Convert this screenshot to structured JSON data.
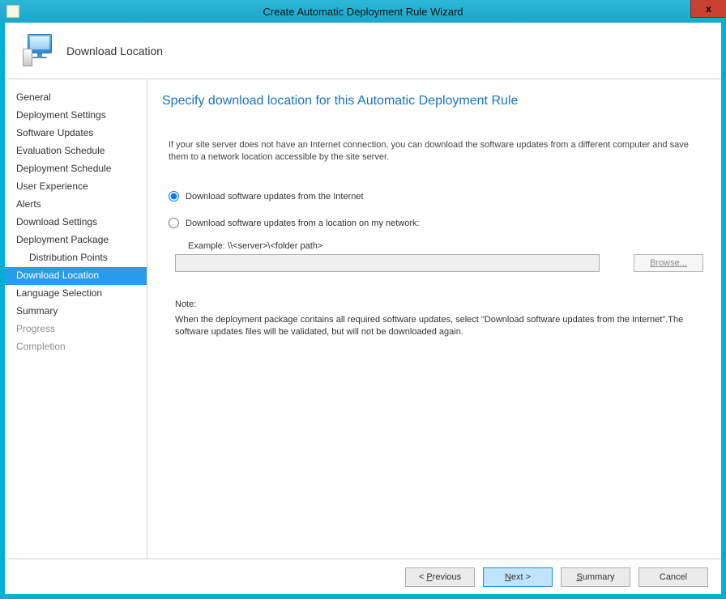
{
  "window": {
    "title": "Create Automatic Deployment Rule Wizard",
    "close": "x"
  },
  "header": {
    "page_title": "Download Location"
  },
  "sidebar": {
    "items": [
      {
        "label": "General",
        "child": false,
        "disabled": false
      },
      {
        "label": "Deployment Settings",
        "child": false,
        "disabled": false
      },
      {
        "label": "Software Updates",
        "child": false,
        "disabled": false
      },
      {
        "label": "Evaluation Schedule",
        "child": false,
        "disabled": false
      },
      {
        "label": "Deployment Schedule",
        "child": false,
        "disabled": false
      },
      {
        "label": "User Experience",
        "child": false,
        "disabled": false
      },
      {
        "label": "Alerts",
        "child": false,
        "disabled": false
      },
      {
        "label": "Download Settings",
        "child": false,
        "disabled": false
      },
      {
        "label": "Deployment Package",
        "child": false,
        "disabled": false
      },
      {
        "label": "Distribution Points",
        "child": true,
        "disabled": false
      },
      {
        "label": "Download Location",
        "child": false,
        "disabled": false,
        "selected": true
      },
      {
        "label": "Language Selection",
        "child": false,
        "disabled": false
      },
      {
        "label": "Summary",
        "child": false,
        "disabled": false
      },
      {
        "label": "Progress",
        "child": false,
        "disabled": true
      },
      {
        "label": "Completion",
        "child": false,
        "disabled": true
      }
    ]
  },
  "content": {
    "heading": "Specify download location for this Automatic Deployment Rule",
    "intro": "If your site server does not have an Internet connection, you can download the software updates from a different computer and save them to a network location accessible by the site server.",
    "radio_internet": "Download software updates from the Internet",
    "radio_local": "Download software updates from a location on my network:",
    "example": "Example: \\\\<server>\\<folder path>",
    "path_value": "",
    "browse": "Browse...",
    "note_label": "Note:",
    "note_text": "When the deployment package contains all required software updates, select \"Download  software updates from the Internet\".The software updates files will be validated, but will not be downloaded again."
  },
  "footer": {
    "previous_pre": "< ",
    "previous_u": "P",
    "previous_post": "revious",
    "next_u": "N",
    "next_post": "ext >",
    "summary_u": "S",
    "summary_post": "ummary",
    "cancel": "Cancel"
  }
}
